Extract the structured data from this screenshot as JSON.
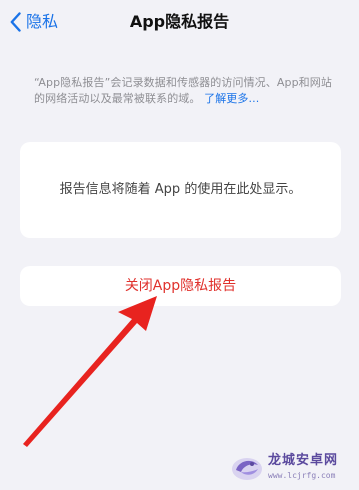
{
  "nav": {
    "back_label": "隐私",
    "title": "App隐私报告"
  },
  "description": {
    "text": "“App隐私报告”会记录数据和传感器的访问情况、App和网站的网络活动以及最常被联系的域。",
    "link": "了解更多..."
  },
  "card": {
    "message": "报告信息将随着 App 的使用在此处显示。"
  },
  "button": {
    "label": "关闭App隐私报告"
  },
  "annotation": {
    "arrow_color": "#e8231f"
  },
  "watermark": {
    "brand": "龙城安卓网",
    "url": "www.lcjrfg.com"
  },
  "colors": {
    "background": "#f2f2f7",
    "accent_blue": "#1a73e8",
    "destructive_red": "#e0312c"
  }
}
